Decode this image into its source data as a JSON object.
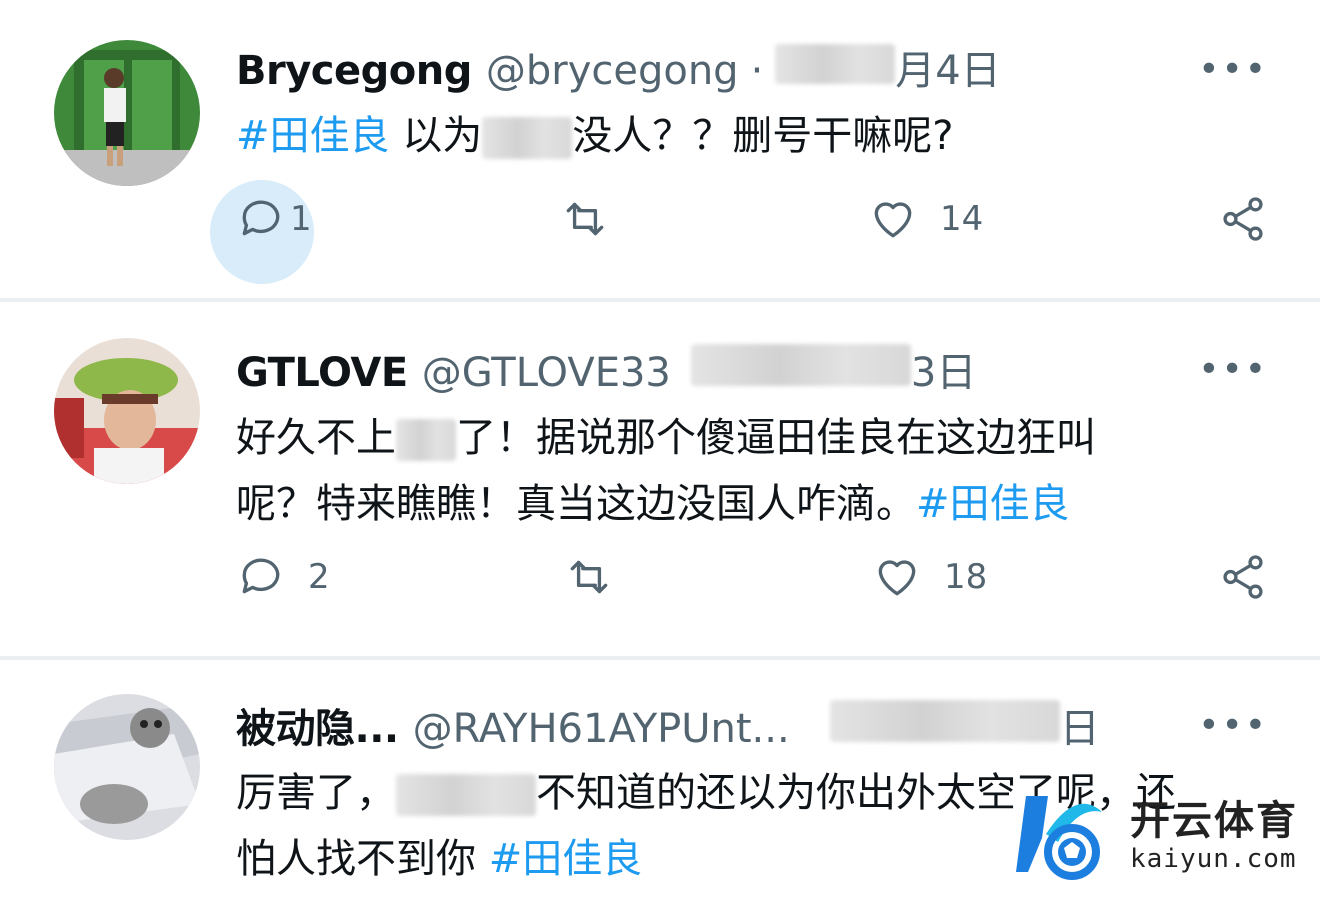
{
  "tweets": [
    {
      "name": "Brycegong",
      "handle": "@brycegong",
      "dot": "·",
      "date": "月4日",
      "more": "•••",
      "lines": [
        [
          {
            "t": "#田佳良",
            "tag": true
          },
          {
            "t": " 以为"
          },
          {
            "blur": 90
          },
          {
            "t": "没人？？删号干嘛呢?"
          }
        ]
      ],
      "actions": {
        "reply": "1",
        "like": "14"
      }
    },
    {
      "name": "GTLOVE",
      "handle": "@GTLOVE33",
      "date": "3日",
      "more": "•••",
      "lines": [
        [
          {
            "t": "好久不上"
          },
          {
            "blur": 60
          },
          {
            "t": "了！据说那个傻逼田佳良在这边狂叫"
          }
        ],
        [
          {
            "t": "呢？特来瞧瞧！真当这边没国人咋滴。"
          },
          {
            "t": "#田佳良",
            "tag": true
          }
        ]
      ],
      "actions": {
        "reply": "2",
        "like": "18"
      }
    },
    {
      "name": "被动隐...",
      "handle": "@RAYH61AYPUnt...",
      "date": "日",
      "more": "•••",
      "lines": [
        [
          {
            "t": "厉害了，"
          },
          {
            "blur": 140
          },
          {
            "t": "不知道的还以为你出外太空了呢，还"
          }
        ],
        [
          {
            "t": "怕人找不到你 "
          },
          {
            "t": "#田佳良",
            "tag": true
          }
        ]
      ],
      "actions": {}
    }
  ],
  "watermark": {
    "title": "开云体育",
    "url": "kaiyun.com"
  },
  "colors": {
    "accent": "#1d9bf0",
    "muted": "#536471",
    "text": "#0f1419"
  }
}
